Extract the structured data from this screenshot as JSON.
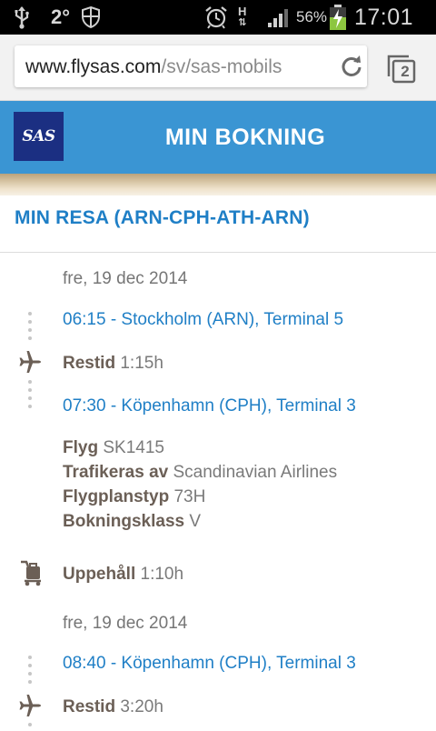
{
  "statusbar": {
    "temperature": "2°",
    "network_type": "H",
    "battery_percent": "56%",
    "time": "17:01",
    "icons": [
      "usb-icon",
      "shield-icon",
      "alarm-icon",
      "signal-icon",
      "battery-charging-icon"
    ]
  },
  "browser": {
    "url_domain": "www.flysas.com",
    "url_path": "/sv/sas-mobils",
    "tab_count": "2"
  },
  "header": {
    "logo_text": "SAS",
    "title": "MIN BOKNING"
  },
  "trip": {
    "title": "MIN RESA (ARN-CPH-ATH-ARN)"
  },
  "segments": [
    {
      "date": "fre, 19 dec 2014",
      "departure": "06:15 - Stockholm (ARN), Terminal 5",
      "travel_time_label": "Restid",
      "travel_time": "1:15h",
      "arrival": "07:30 - Köpenhamn (CPH), Terminal 3",
      "details": [
        {
          "label": "Flyg",
          "value": "SK1415"
        },
        {
          "label": "Trafikeras av",
          "value": "Scandinavian Airlines"
        },
        {
          "label": "Flygplanstyp",
          "value": "73H"
        },
        {
          "label": "Bokningsklass",
          "value": "V"
        }
      ]
    },
    {
      "date": "fre, 19 dec 2014",
      "departure": "08:40 - Köpenhamn (CPH), Terminal 3",
      "travel_time_label": "Restid",
      "travel_time": "3:20h"
    }
  ],
  "layover": {
    "label": "Uppehåll",
    "value": "1:10h"
  },
  "colors": {
    "header_blue": "#3a95d3",
    "logo_navy": "#1b2f82",
    "link_blue": "#1f7fc6",
    "label_brown": "#6b5f56"
  }
}
